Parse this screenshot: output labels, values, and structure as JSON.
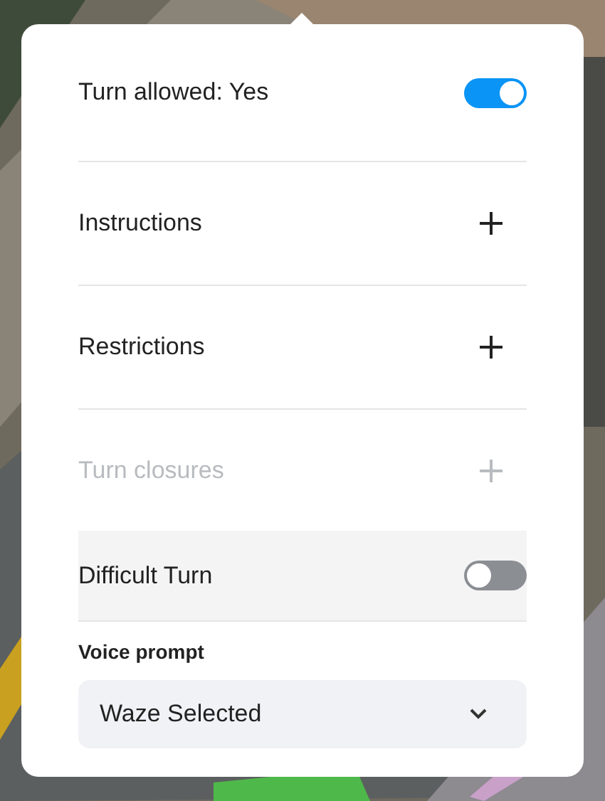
{
  "turn_allowed": {
    "label": "Turn allowed: Yes",
    "on": true
  },
  "sections": [
    {
      "label": "Instructions",
      "disabled": false
    },
    {
      "label": "Restrictions",
      "disabled": false
    },
    {
      "label": "Turn closures",
      "disabled": true
    }
  ],
  "difficult_turn": {
    "label": "Difficult Turn",
    "on": false
  },
  "voice_prompt": {
    "label": "Voice prompt",
    "value": "Waze Selected"
  }
}
